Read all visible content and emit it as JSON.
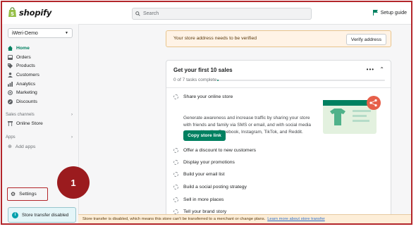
{
  "topbar": {
    "logo_text": "shopify",
    "search_placeholder": "Search",
    "setup_guide": "Setup guide"
  },
  "sidebar": {
    "store_name": "iWeri-Demo",
    "nav": [
      {
        "label": "Home",
        "icon": "home-icon",
        "active": true
      },
      {
        "label": "Orders",
        "icon": "orders-icon"
      },
      {
        "label": "Products",
        "icon": "tag-icon"
      },
      {
        "label": "Customers",
        "icon": "person-icon"
      },
      {
        "label": "Analytics",
        "icon": "bar-chart-icon"
      },
      {
        "label": "Marketing",
        "icon": "target-icon"
      },
      {
        "label": "Discounts",
        "icon": "discount-icon"
      }
    ],
    "sales_channels_label": "Sales channels",
    "online_store": "Online Store",
    "apps_label": "Apps",
    "add_apps": "Add apps",
    "settings": "Settings",
    "store_transfer": "Store transfer disabled"
  },
  "callout": {
    "number": "1"
  },
  "banner": {
    "message": "Your store address needs to be verified",
    "button": "Verify address"
  },
  "card": {
    "title": "Get your first 10 sales",
    "progress_text": "0 of 7 tasks complete",
    "progress_fraction": 0,
    "share_title": "Share your online store",
    "share_desc": "Generate awareness and increase traffic by sharing your store with friends and family via SMS or email, and with social media communities like Facebook, Instagram, TikTok, and Reddit.",
    "copy_button": "Copy store link",
    "tasks": [
      "Offer a discount to new customers",
      "Display your promotions",
      "Build your email list",
      "Build a social posting strategy",
      "Sell in more places",
      "Tell your brand story"
    ]
  },
  "bottom_bar": {
    "message": "Store transfer is disabled, which means this store can't be transferred to a merchant or change plans.",
    "link": "Learn more about store transfer"
  },
  "colors": {
    "accent": "#008060",
    "highlight": "#b3262b"
  }
}
